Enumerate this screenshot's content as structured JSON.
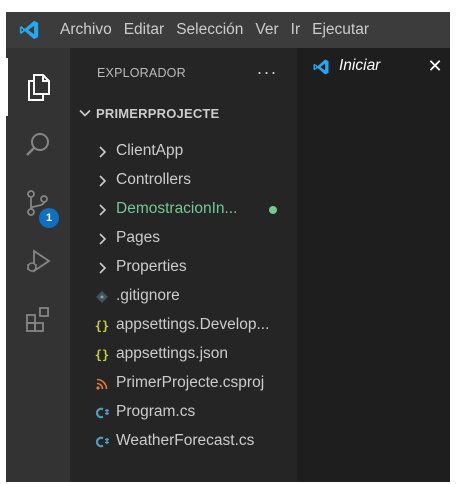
{
  "menubar": {
    "logo_icon": "vscode-logo-icon",
    "items": [
      "Archivo",
      "Editar",
      "Selección",
      "Ver",
      "Ir",
      "Ejecutar"
    ]
  },
  "activitybar": {
    "items": [
      {
        "name": "explorer",
        "icon": "files-icon",
        "active": true
      },
      {
        "name": "search",
        "icon": "search-icon"
      },
      {
        "name": "source-control",
        "icon": "source-control-icon",
        "badge": "1"
      },
      {
        "name": "run-debug",
        "icon": "run-debug-icon"
      },
      {
        "name": "extensions",
        "icon": "extensions-icon"
      }
    ]
  },
  "sidebar": {
    "title": "EXPLORADOR",
    "more_actions": "···",
    "project": "PRIMERPROJECTE",
    "tree": [
      {
        "label": "ClientApp",
        "type": "folder"
      },
      {
        "label": "Controllers",
        "type": "folder"
      },
      {
        "label": "DemostracionIn...",
        "type": "folder",
        "modified": true
      },
      {
        "label": "Pages",
        "type": "folder"
      },
      {
        "label": "Properties",
        "type": "folder"
      },
      {
        "label": ".gitignore",
        "type": "file",
        "icon": "git-icon"
      },
      {
        "label": "appsettings.Develop...",
        "type": "file",
        "icon": "json-icon",
        "glyph": "{}"
      },
      {
        "label": "appsettings.json",
        "type": "file",
        "icon": "json-icon",
        "glyph": "{}"
      },
      {
        "label": "PrimerProjecte.csproj",
        "type": "file",
        "icon": "rss-icon"
      },
      {
        "label": "Program.cs",
        "type": "file",
        "icon": "csharp-icon",
        "glyph": "C#"
      },
      {
        "label": "WeatherForecast.cs",
        "type": "file",
        "icon": "csharp-icon",
        "glyph": "C#"
      }
    ]
  },
  "editor": {
    "tab_label": "Iniciar",
    "tab_close": "✕"
  },
  "colors": {
    "accent_blue": "#0e70c0",
    "modified_green": "#73c991",
    "vscode_blue": "#23a9f2",
    "json_yellow": "#cbcb41",
    "csharp_blue": "#519aba",
    "rss_orange": "#e37933"
  }
}
